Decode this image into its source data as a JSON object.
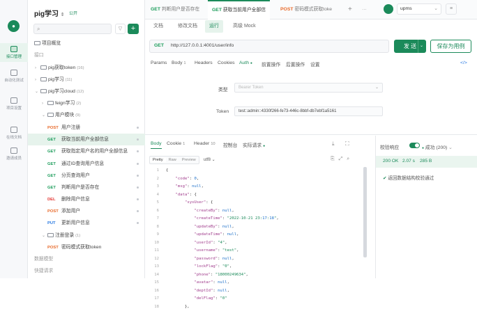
{
  "rail": {
    "items": [
      {
        "label": "接口管理",
        "icon": "api-icon"
      },
      {
        "label": "自动化测试",
        "icon": "flask-icon"
      },
      {
        "label": "项目设置",
        "icon": "settings-icon"
      },
      {
        "label": "在线文档",
        "icon": "book-icon"
      },
      {
        "label": "邀请成员",
        "icon": "invite-icon"
      }
    ]
  },
  "sidebar": {
    "project": "pig学习",
    "badge": "公开",
    "search_placeholder": "",
    "tree": [
      {
        "text": "项目概览"
      },
      {
        "text": "接口"
      },
      {
        "text": "pig获取token",
        "count": "(16)"
      },
      {
        "text": "pig学习",
        "count": "(11)"
      },
      {
        "text": "pig学习cloud",
        "count": "(12)"
      },
      {
        "text": "feign学习",
        "count": "(2)"
      },
      {
        "text": "用户模块",
        "count": "(9)"
      },
      {
        "method": "POST",
        "text": "用户注册"
      },
      {
        "method": "GET",
        "text": "获取当前用户全部信息"
      },
      {
        "method": "GET",
        "text": "获取指定用户名的用户全部信息"
      },
      {
        "method": "GET",
        "text": "通过ID查询用户信息"
      },
      {
        "method": "GET",
        "text": "分页查询用户"
      },
      {
        "method": "GET",
        "text": "判断用户是否存在"
      },
      {
        "method": "DEL",
        "text": "删除用户信息"
      },
      {
        "method": "POST",
        "text": "添加用户"
      },
      {
        "method": "PUT",
        "text": "更新用户信息"
      },
      {
        "text": "注册登录",
        "count": "(1)"
      },
      {
        "method": "POST",
        "text": "密码模式获取token"
      },
      {
        "text": "数据模型"
      },
      {
        "text": "快捷请求"
      }
    ]
  },
  "tabs": [
    {
      "method": "GET",
      "text": "判断用户是否存在"
    },
    {
      "method": "GET",
      "text": "获取当前用户全部信"
    },
    {
      "method": "POST",
      "text": "密码模式获取toke"
    }
  ],
  "env": "upms",
  "subtabs": [
    "文档",
    "修改文档",
    "运行",
    "高级 Mock"
  ],
  "request": {
    "method": "GET",
    "url": "http://127.0.0.1:4001/user/info",
    "send": "发 送",
    "save": "保存为用例"
  },
  "req_tabs": [
    {
      "text": "Params"
    },
    {
      "text": "Body",
      "count": "1"
    },
    {
      "text": "Headers"
    },
    {
      "text": "Cookies"
    },
    {
      "text": "Auth"
    },
    {
      "text": "前置操作"
    },
    {
      "text": "后置操作"
    },
    {
      "text": "设置"
    }
  ],
  "auth": {
    "type_label": "类型",
    "type_value": "Bearer Token",
    "token_label": "Token",
    "token_value": "test::admin::4330f266-fe73-446c-8bbf-db7ebf1a5161"
  },
  "resp_tabs": [
    {
      "text": "Body"
    },
    {
      "text": "Cookie",
      "count": "1"
    },
    {
      "text": "Header",
      "count": "10"
    },
    {
      "text": "控制台"
    },
    {
      "text": "实际请求"
    }
  ],
  "resp_format": [
    "Pretty",
    "Raw",
    "Preview"
  ],
  "resp_encoding": "utf8",
  "code": [
    "{",
    "    \"code\": 0,",
    "    \"msg\": null,",
    "    \"data\": {",
    "        \"sysUser\": {",
    "            \"createBy\": null,",
    "            \"createTime\": \"2022-10-21 23:17:18\",",
    "            \"updateBy\": null,",
    "            \"updateTime\": null,",
    "            \"userId\": \"4\",",
    "            \"username\": \"test\",",
    "            \"password\": null,",
    "            \"lockFlag\": \"0\",",
    "            \"phone\": \"18000249634\",",
    "            \"avatar\": null,",
    "            \"deptId\": null,",
    "            \"delFlag\": \"0\"",
    "        },"
  ],
  "validation": {
    "label": "校验响应",
    "status": "成功 (200)",
    "code": "200 OK",
    "time": "2.07 s",
    "size": "285 B",
    "result": "返回数据结构校验通过"
  }
}
